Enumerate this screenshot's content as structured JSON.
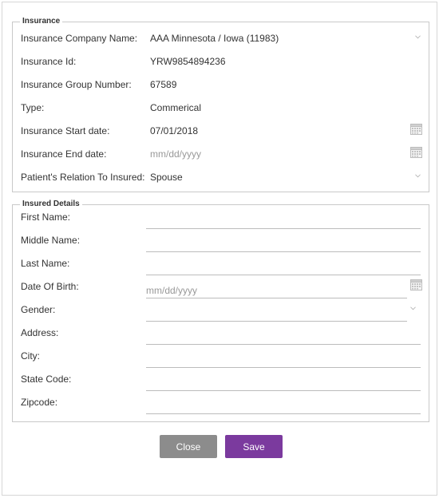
{
  "insurance": {
    "legend": "Insurance",
    "company": {
      "label": "Insurance Company Name:",
      "value": "AAA Minnesota / Iowa (11983)"
    },
    "id": {
      "label": "Insurance Id:",
      "value": "YRW9854894236"
    },
    "group_number": {
      "label": "Insurance Group Number:",
      "value": "67589"
    },
    "type": {
      "label": "Type:",
      "value": "Commerical"
    },
    "start_date": {
      "label": "Insurance Start date:",
      "value": "07/01/2018"
    },
    "end_date": {
      "label": "Insurance End date:",
      "placeholder": "mm/dd/yyyy"
    },
    "relation": {
      "label": "Patient's Relation To Insured:",
      "value": "Spouse"
    }
  },
  "insured": {
    "legend": "Insured Details",
    "first_name": {
      "label": "First Name:",
      "value": ""
    },
    "middle_name": {
      "label": "Middle Name:",
      "value": ""
    },
    "last_name": {
      "label": "Last Name:",
      "value": ""
    },
    "dob": {
      "label": "Date Of Birth:",
      "placeholder": "mm/dd/yyyy"
    },
    "gender": {
      "label": "Gender:",
      "value": ""
    },
    "address": {
      "label": "Address:",
      "value": ""
    },
    "city": {
      "label": "City:",
      "value": ""
    },
    "state_code": {
      "label": "State Code:",
      "value": ""
    },
    "zipcode": {
      "label": "Zipcode:",
      "value": ""
    }
  },
  "actions": {
    "close_label": "Close",
    "save_label": "Save"
  },
  "colors": {
    "save_button": "#7b3a9e",
    "close_button": "#8c8c8c",
    "border": "#c9c9c9"
  },
  "icons": {
    "dropdown": "chevron-down-icon",
    "date": "calendar-icon"
  }
}
